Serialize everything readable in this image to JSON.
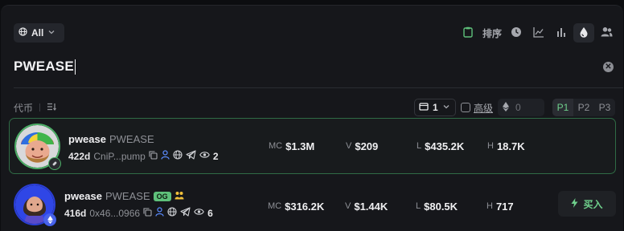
{
  "filter": {
    "label": "All"
  },
  "toolbar": {
    "sort_label": "排序"
  },
  "search": {
    "query": "PWEASE"
  },
  "list_header": {
    "tokens_label": "代币",
    "count_value": "1",
    "advanced_label": "高级",
    "eth_placeholder": "0",
    "presets": [
      "P1",
      "P2",
      "P3"
    ],
    "active_preset": "P1"
  },
  "tokens": [
    {
      "name": "pwease",
      "ticker": "PWEASE",
      "og_badge": "",
      "age": "422d",
      "address": "CniP...pump",
      "holders": "2",
      "mc_label": "MC",
      "mc": "$1.3M",
      "v_label": "V",
      "v": "$209",
      "l_label": "L",
      "l": "$435.2K",
      "h_label": "H",
      "h": "18.7K",
      "buy_label": ""
    },
    {
      "name": "pwease",
      "ticker": "PWEASE",
      "og_badge": "OG",
      "age": "416d",
      "address": "0x46...0966",
      "holders": "6",
      "mc_label": "MC",
      "mc": "$316.2K",
      "v_label": "V",
      "v": "$1.44K",
      "l_label": "L",
      "l": "$80.5K",
      "h_label": "H",
      "h": "717",
      "buy_label": "买入"
    }
  ],
  "colors": {
    "accent_green": "#5ec07a",
    "active_border": "#2f6b45",
    "chain_blue": "#2b3fd8"
  }
}
